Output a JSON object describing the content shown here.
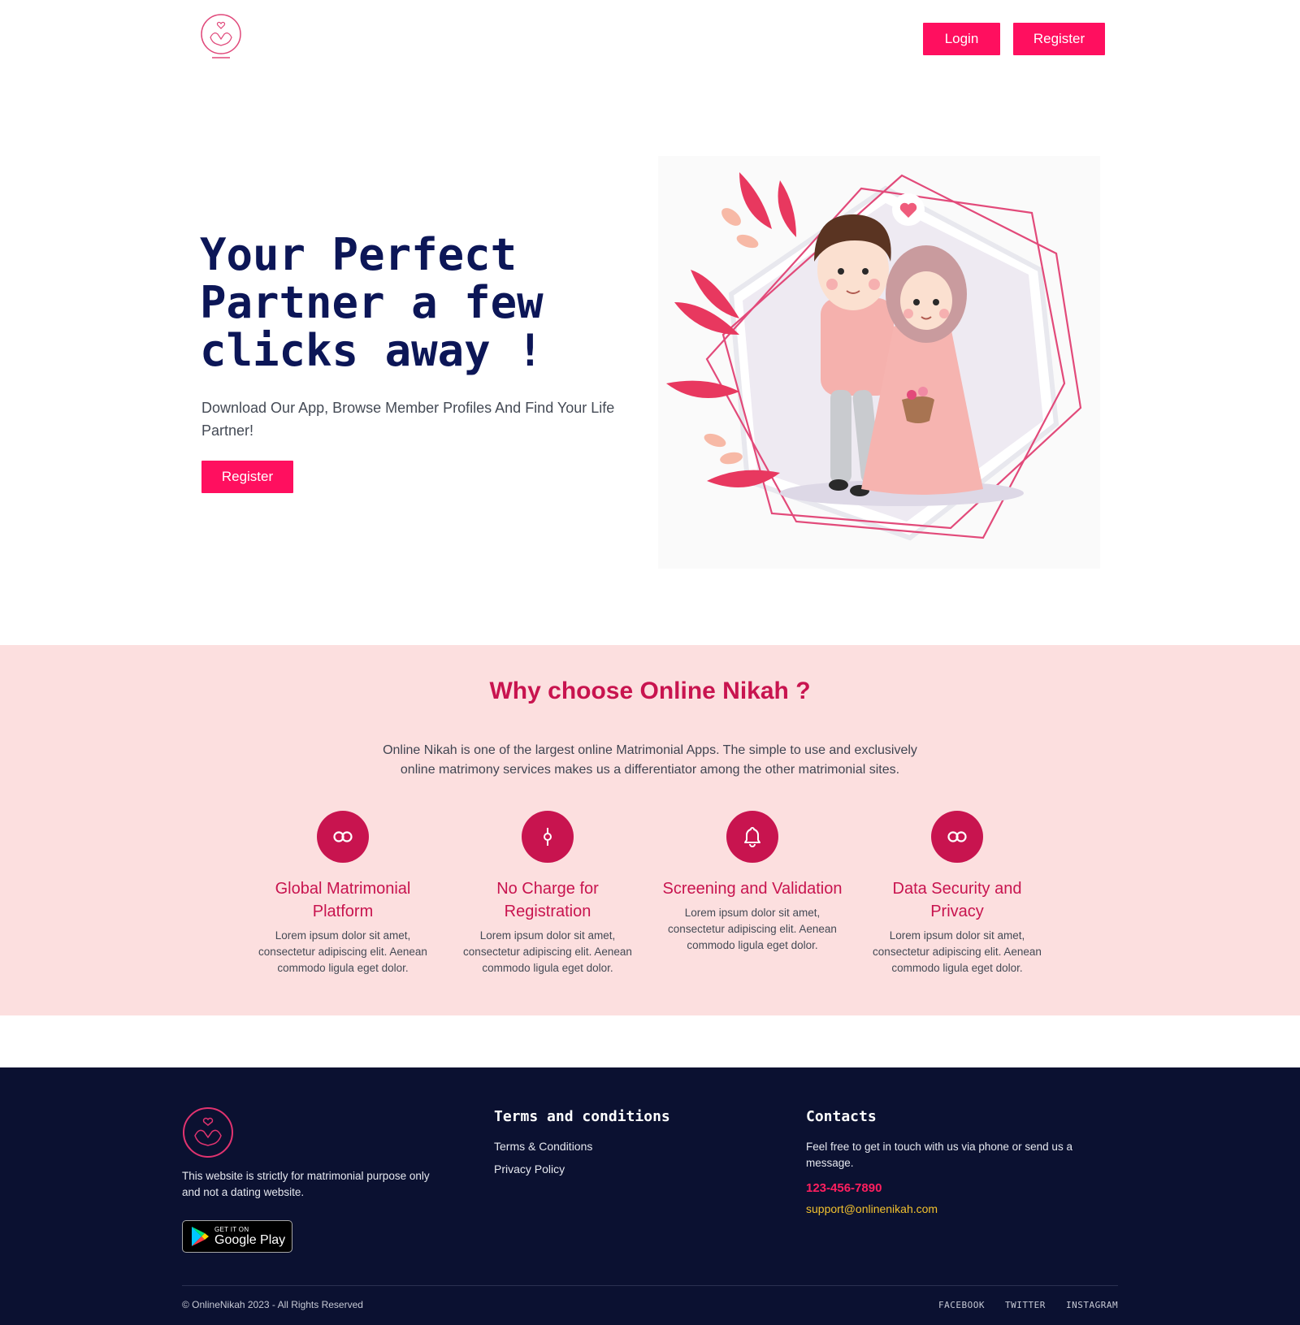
{
  "header": {
    "login_label": "Login",
    "register_label": "Register"
  },
  "hero": {
    "title": "Your Perfect Partner a few clicks away !",
    "subtitle": "Download Our App, Browse Member Profiles And Find Your Life Partner!",
    "register_label": "Register"
  },
  "why": {
    "title": "Why choose Online Nikah ?",
    "description": "Online Nikah is one of the largest online Matrimonial Apps. The simple to use and exclusively online matrimony services makes us a differentiator among the other matrimonial sites.",
    "features": [
      {
        "icon": "infinity-icon",
        "title": "Global Matrimonial Platform",
        "text": "Lorem ipsum dolor sit amet, consectetur adipiscing elit. Aenean commodo ligula eget dolor."
      },
      {
        "icon": "pin-icon",
        "title": "No Charge for Registration",
        "text": "Lorem ipsum dolor sit amet, consectetur adipiscing elit. Aenean commodo ligula eget dolor."
      },
      {
        "icon": "bell-icon",
        "title": "Screening and Validation",
        "text": "Lorem ipsum dolor sit amet, consectetur adipiscing elit. Aenean commodo ligula eget dolor."
      },
      {
        "icon": "infinity-icon",
        "title": "Data Security and Privacy",
        "text": "Lorem ipsum dolor sit amet, consectetur adipiscing elit. Aenean commodo ligula eget dolor."
      }
    ]
  },
  "footer": {
    "about": "This website is strictly for matrimonial purpose only and not a dating website.",
    "google_play": {
      "small": "GET IT ON",
      "big": "Google Play"
    },
    "terms_heading": "Terms and conditions",
    "terms_links": [
      "Terms & Conditions",
      "Privacy Policy"
    ],
    "contacts_heading": "Contacts",
    "contacts_text": "Feel free to get in touch with us via phone or send us a message.",
    "phone": "123-456-7890",
    "email": "support@onlinenikah.com",
    "copyright": "© OnlineNikah 2023 - All Rights Reserved",
    "social": [
      "FACEBOOK",
      "TWITTER",
      "INSTAGRAM"
    ]
  },
  "colors": {
    "accent": "#ff0f5f",
    "brand_crimson": "#c8144f",
    "navy": "#0c1657",
    "section_bg": "#fcdfdf",
    "footer_bg": "#0b1131",
    "email": "#f2c12e"
  }
}
